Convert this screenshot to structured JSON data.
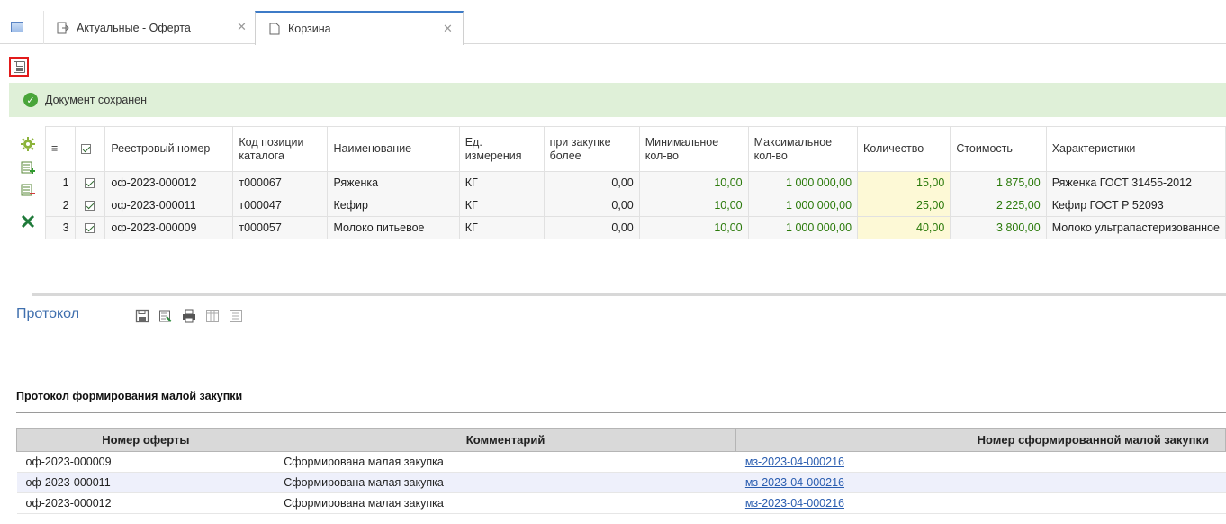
{
  "tabs": [
    {
      "label": "Актуальные - Оферта"
    },
    {
      "label": "Корзина"
    }
  ],
  "status": {
    "message": "Документ сохранен"
  },
  "grid": {
    "columns": [
      "Реестровый номер",
      "Код позиции каталога",
      "Наименование",
      "Ед. измерения",
      "при закупке более",
      "Минимальное кол-во",
      "Максимальное кол-во",
      "Количество",
      "Стоимость",
      "Характеристики"
    ],
    "rows": [
      {
        "n": "1",
        "reg": "оф-2023-000012",
        "code": "т000067",
        "name": "Ряженка",
        "unit": "КГ",
        "over": "0,00",
        "min": "10,00",
        "max": "1 000 000,00",
        "qty": "15,00",
        "cost": "1 875,00",
        "chars": "Ряженка ГОСТ 31455-2012"
      },
      {
        "n": "2",
        "reg": "оф-2023-000011",
        "code": "т000047",
        "name": "Кефир",
        "unit": "КГ",
        "over": "0,00",
        "min": "10,00",
        "max": "1 000 000,00",
        "qty": "25,00",
        "cost": "2 225,00",
        "chars": "Кефир ГОСТ Р 52093"
      },
      {
        "n": "3",
        "reg": "оф-2023-000009",
        "code": "т000057",
        "name": "Молоко питьевое",
        "unit": "КГ",
        "over": "0,00",
        "min": "10,00",
        "max": "1 000 000,00",
        "qty": "40,00",
        "cost": "3 800,00",
        "chars": "Молоко ультрапастеризованное"
      }
    ]
  },
  "protocol": {
    "title": "Протокол",
    "report_title": "Протокол формирования малой закупки",
    "columns": [
      "Номер оферты",
      "Комментарий",
      "Номер сформированной малой закупки"
    ],
    "rows": [
      {
        "offer": "оф-2023-000009",
        "comment": "Сформирована малая закупка",
        "purchase": "мз-2023-04-000216"
      },
      {
        "offer": "оф-2023-000011",
        "comment": "Сформирована малая закупка",
        "purchase": "мз-2023-04-000216"
      },
      {
        "offer": "оф-2023-000012",
        "comment": "Сформирована малая закупка",
        "purchase": "мз-2023-04-000216"
      }
    ]
  },
  "colors": {
    "accent": "#3d7bc7",
    "success_bg": "#dff0d8",
    "highlight": "#e21b1b",
    "quantity_bg": "#fdf9d6"
  }
}
